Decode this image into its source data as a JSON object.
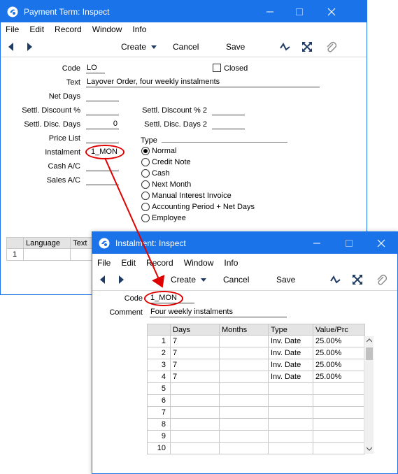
{
  "window1": {
    "title": "Payment Term: Inspect",
    "menu": [
      "File",
      "Edit",
      "Record",
      "Window",
      "Info"
    ],
    "toolbar": {
      "create": "Create",
      "cancel": "Cancel",
      "save": "Save"
    },
    "fields": {
      "code_label": "Code",
      "code_value": "LO",
      "closed_label": "Closed",
      "text_label": "Text",
      "text_value": "Layover Order, four weekly instalments",
      "net_days_label": "Net Days",
      "net_days_value": "",
      "settl_discount_label": "Settl. Discount %",
      "settl_discount_value": "",
      "settl_discount2_label": "Settl. Discount % 2",
      "settl_discount2_value": "",
      "settl_disc_days_label": "Settl. Disc. Days",
      "settl_disc_days_value": "0",
      "settl_disc_days2_label": "Settl. Disc. Days 2",
      "settl_disc_days2_value": "",
      "price_list_label": "Price List",
      "price_list_value": "",
      "instalment_label": "Instalment",
      "instalment_value": "1_MON",
      "cash_ac_label": "Cash A/C",
      "cash_ac_value": "",
      "sales_ac_label": "Sales A/C",
      "sales_ac_value": "",
      "type_label": "Type"
    },
    "type_options": [
      "Normal",
      "Credit Note",
      "Cash",
      "Next Month",
      "Manual Interest Invoice",
      "Accounting Period + Net Days",
      "Employee"
    ],
    "type_selected": "Normal",
    "language_table": {
      "headers": [
        "Language",
        "Text"
      ],
      "rows": [
        [
          "1",
          "",
          ""
        ]
      ]
    }
  },
  "window2": {
    "title": "Instalment: Inspect",
    "menu": [
      "File",
      "Edit",
      "Record",
      "Window",
      "Info"
    ],
    "toolbar": {
      "create": "Create",
      "cancel": "Cancel",
      "save": "Save"
    },
    "fields": {
      "code_label": "Code",
      "code_value": "1_MON",
      "comment_label": "Comment",
      "comment_value": "Four weekly instalments"
    },
    "table": {
      "headers": [
        "Days",
        "Months",
        "Type",
        "Value/Prc"
      ],
      "rows": [
        [
          "1",
          "7",
          "",
          "Inv. Date",
          "25.00%"
        ],
        [
          "2",
          "7",
          "",
          "Inv. Date",
          "25.00%"
        ],
        [
          "3",
          "7",
          "",
          "Inv. Date",
          "25.00%"
        ],
        [
          "4",
          "7",
          "",
          "Inv. Date",
          "25.00%"
        ],
        [
          "5",
          "",
          "",
          "",
          ""
        ],
        [
          "6",
          "",
          "",
          "",
          ""
        ],
        [
          "7",
          "",
          "",
          "",
          ""
        ],
        [
          "8",
          "",
          "",
          "",
          ""
        ],
        [
          "9",
          "",
          "",
          "",
          ""
        ],
        [
          "10",
          "",
          "",
          "",
          ""
        ]
      ]
    }
  },
  "colors": {
    "titlebar": "#1a73e8",
    "highlight": "#e00000",
    "toolbar_icon": "#1f3b63"
  }
}
